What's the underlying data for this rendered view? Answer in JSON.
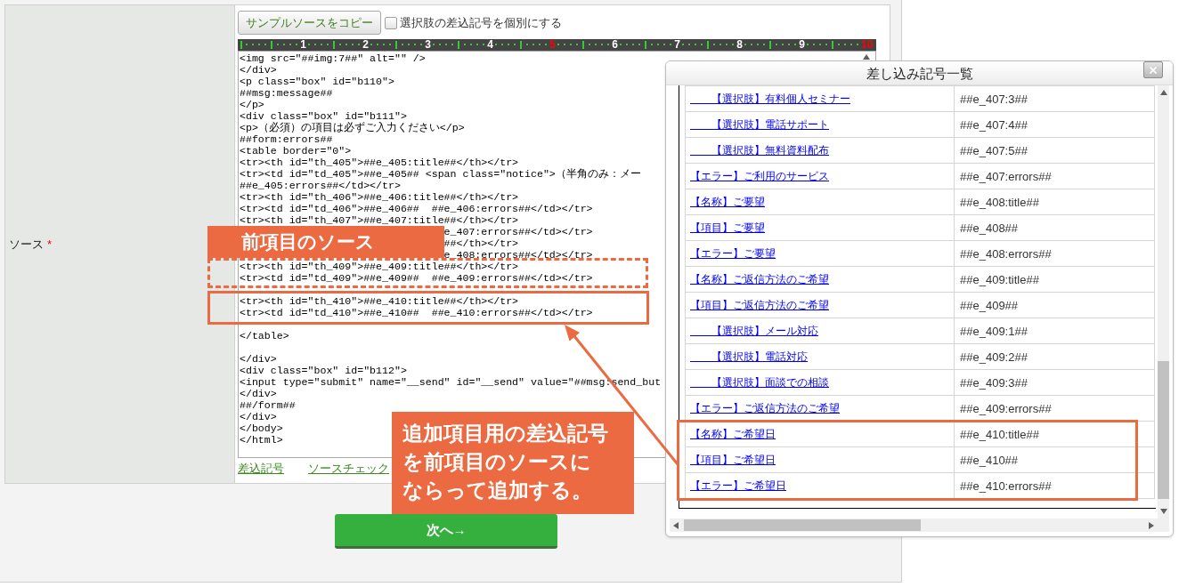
{
  "form": {
    "label": "ソース",
    "required_mark": "*",
    "copy_button": "サンプルソースをコピー",
    "checkbox": {
      "label": "選択肢の差込記号を個別にする",
      "checked": false
    },
    "ruler": [
      {
        "label": "1",
        "highlighted": false
      },
      {
        "label": "2",
        "highlighted": false
      },
      {
        "label": "3",
        "highlighted": false
      },
      {
        "label": "4",
        "highlighted": false
      },
      {
        "label": "5",
        "highlighted": true
      },
      {
        "label": "6",
        "highlighted": false
      },
      {
        "label": "7",
        "highlighted": false
      },
      {
        "label": "8",
        "highlighted": false
      },
      {
        "label": "9",
        "highlighted": false
      },
      {
        "label": "10",
        "highlighted": true
      }
    ],
    "code_lines": [
      {
        "kind": "line",
        "text": "<img src=\"##img:7##\" alt=\"\" />"
      },
      {
        "kind": "line",
        "text": "</div>"
      },
      {
        "kind": "line",
        "text": "<p class=\"box\" id=\"b110\">"
      },
      {
        "kind": "line",
        "text": "##msg:message##"
      },
      {
        "kind": "line",
        "text": "</p>"
      },
      {
        "kind": "line",
        "text": "<div class=\"box\" id=\"b111\">"
      },
      {
        "kind": "line",
        "text": "<p>（必須）の項目は必ずご入力ください</p>"
      },
      {
        "kind": "line",
        "text": "##form:errors##"
      },
      {
        "kind": "line",
        "text": "<table border=\"0\">"
      },
      {
        "kind": "line",
        "text": "<tr><th id=\"th_405\">##e_405:title##</th></tr>"
      },
      {
        "kind": "line",
        "text": "<tr><td id=\"td_405\">##e_405## <span class=\"notice\">（半角のみ：メー"
      },
      {
        "kind": "line",
        "text": "##e_405:errors##</td></tr>"
      },
      {
        "kind": "line",
        "text": "<tr><th id=\"th_406\">##e_406:title##</th></tr>"
      },
      {
        "kind": "line",
        "text": "<tr><td id=\"td_406\">##e_406##  ##e_406:errors##</td></tr>"
      },
      {
        "kind": "line",
        "text": "<tr><th id=\"th_407\">##e_407:title##</th></tr>"
      },
      {
        "kind": "covered",
        "text": "e_407:errors##</td></tr>"
      },
      {
        "kind": "covered",
        "text": "##</th></tr>"
      },
      {
        "kind": "covered",
        "text": "e_408:errors##</td></tr>"
      },
      {
        "kind": "line",
        "text": "<tr><th id=\"th_409\">##e_409:title##</th></tr>"
      },
      {
        "kind": "line",
        "text": "<tr><td id=\"td_409\">##e_409##  ##e_409:errors##</td></tr>"
      },
      {
        "kind": "blank"
      },
      {
        "kind": "line",
        "text": "<tr><th id=\"th_410\">##e_410:title##</th></tr>"
      },
      {
        "kind": "line",
        "text": "<tr><td id=\"td_410\">##e_410##  ##e_410:errors##</td></tr>"
      },
      {
        "kind": "blank"
      },
      {
        "kind": "line",
        "text": "</table>"
      },
      {
        "kind": "blank"
      },
      {
        "kind": "line",
        "text": "</div>"
      },
      {
        "kind": "line",
        "text": "<div class=\"box\" id=\"b112\">"
      },
      {
        "kind": "line",
        "text": "<input type=\"submit\" name=\"__send\" id=\"__send\" value=\"##msg:send_but"
      },
      {
        "kind": "line",
        "text": "</div>"
      },
      {
        "kind": "line",
        "text": "##/form##"
      },
      {
        "kind": "line",
        "text": "</div>"
      },
      {
        "kind": "line",
        "text": "</body>"
      },
      {
        "kind": "line",
        "text": "</html>"
      }
    ],
    "links": [
      "差込記号",
      "ソースチェック"
    ]
  },
  "next_button": "次へ→",
  "dialog": {
    "title": "差し込み記号一覧",
    "rows": [
      {
        "label": "　　【選択肢】有料個人セミナー",
        "code": "##e_407:3##"
      },
      {
        "label": "　　【選択肢】電話サポート",
        "code": "##e_407:4##"
      },
      {
        "label": "　　【選択肢】無料資料配布",
        "code": "##e_407:5##"
      },
      {
        "label": "【エラー】ご利用のサービス",
        "code": "##e_407:errors##"
      },
      {
        "label": "【名称】ご要望",
        "code": "##e_408:title##"
      },
      {
        "label": "【項目】ご要望",
        "code": "##e_408##"
      },
      {
        "label": "【エラー】ご要望",
        "code": "##e_408:errors##"
      },
      {
        "label": "【名称】ご返信方法のご希望",
        "code": "##e_409:title##"
      },
      {
        "label": "【項目】ご返信方法のご希望",
        "code": "##e_409##"
      },
      {
        "label": "　　【選択肢】メール対応",
        "code": "##e_409:1##"
      },
      {
        "label": "　　【選択肢】電話対応",
        "code": "##e_409:2##"
      },
      {
        "label": "　　【選択肢】面談での相談",
        "code": "##e_409:3##"
      },
      {
        "label": "【エラー】ご返信方法のご希望",
        "code": "##e_409:errors##"
      },
      {
        "label": "【名称】ご希望日",
        "code": "##e_410:title##"
      },
      {
        "label": "【項目】ご希望日",
        "code": "##e_410##"
      },
      {
        "label": "【エラー】ご希望日",
        "code": "##e_410:errors##"
      }
    ]
  },
  "annotations": {
    "source_label": "前項目のソース",
    "callout": [
      "追加項目用の差込記号",
      "を前項目のソースに",
      "ならって追加する。"
    ]
  }
}
